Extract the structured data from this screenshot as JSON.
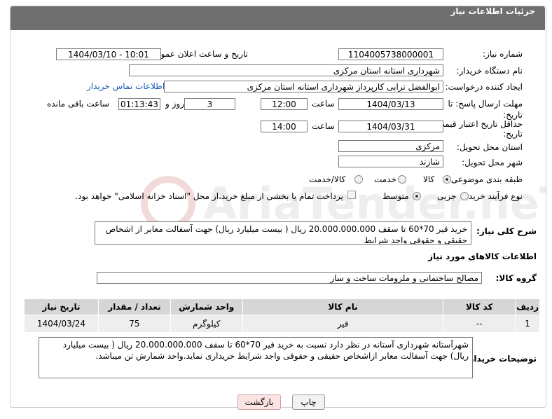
{
  "header": {
    "title": "جزئیات اطلاعات نیاز"
  },
  "fields": {
    "need_number_label": "شماره نیاز:",
    "need_number": "1104005738000001",
    "announce_label": "تاریخ و ساعت اعلان عمومی:",
    "announce_value": "1404/03/10 - 10:01",
    "buyer_org_label": "نام دستگاه خریدار:",
    "buyer_org": "شهرداری استانه استان مرکزی",
    "creator_label": "ایجاد کننده درخواست:",
    "creator": "ابوالفضل  ترابی  کارپرداز  شهرداری استانه استان مرکزی",
    "contact_link": "اطلاعات تماس خریدار",
    "deadline_label": "مهلت ارسال پاسخ: تا تاریخ:",
    "deadline_date": "1404/03/13",
    "time_label": "ساعت",
    "deadline_time": "12:00",
    "days_value": "3",
    "days_label": "روز و",
    "remaining_time": "01:13:43",
    "remaining_label": "ساعت باقی مانده",
    "min_price_label": "حداقل تاریخ اعتبار قیمت: تا تاریخ:",
    "min_price_date": "1404/03/31",
    "min_price_time": "14:00",
    "province_label": "استان محل تحویل:",
    "province": "مرکزی",
    "city_label": "شهر محل تحویل:",
    "city": "شازند",
    "category_label": "طبقه بندی موضوعی:",
    "category_options": [
      "کالا",
      "خدمت",
      "کالا/خدمت"
    ],
    "process_label": "نوع فرآیند خرید :",
    "process_options": [
      "جزیی",
      "متوسط"
    ],
    "payment_note": "پرداخت تمام یا بخشی از مبلغ خرید،از محل \"اسناد خزانه اسلامی\" خواهد بود."
  },
  "description": {
    "label": "شرح کلی نیاز:",
    "text": "خرید قیر 70*60 تا سقف 20.000.000.000 ریال ( بیست میلیارد ریال)  جهت  آسفالت  معابر از اشخاص حقیقی و حقوقی  واجد شرایط"
  },
  "goods": {
    "section_title": "اطلاعات کالاهای مورد نیاز",
    "group_label": "گروه کالا:",
    "group_value": "مصالح ساختمانی و ملزومات ساخت و ساز",
    "columns": [
      "ردیف",
      "کد کالا",
      "نام کالا",
      "واحد شمارش",
      "تعداد / مقدار",
      "تاریخ نیاز"
    ],
    "rows": [
      {
        "index": "1",
        "code": "--",
        "name": "قیر",
        "unit": "کیلوگرم",
        "qty": "75",
        "date": "1404/03/24"
      }
    ]
  },
  "buyer_notes": {
    "label": "توضیحات خریدار:",
    "text": "شهرآستانه شهرداری آستانه در نظر دارد  نسبت  به خرید قیر 70*60 تا سقف 20.000.000.000 ریال ( بیست میلیارد ریال)  جهت  آسفالت  معابر ازاشخاص حقیقی و حقوقی واجد شرایط خریداری نماید.واحد شمارش تن میباشد."
  },
  "buttons": {
    "print": "چاپ",
    "back": "بازگشت"
  },
  "watermark": {
    "text": "AriaTender.neT"
  },
  "colors": {
    "header_bg": "#6f6f6f",
    "link": "#1a5fb4",
    "back_button": "#fbe3e3"
  }
}
